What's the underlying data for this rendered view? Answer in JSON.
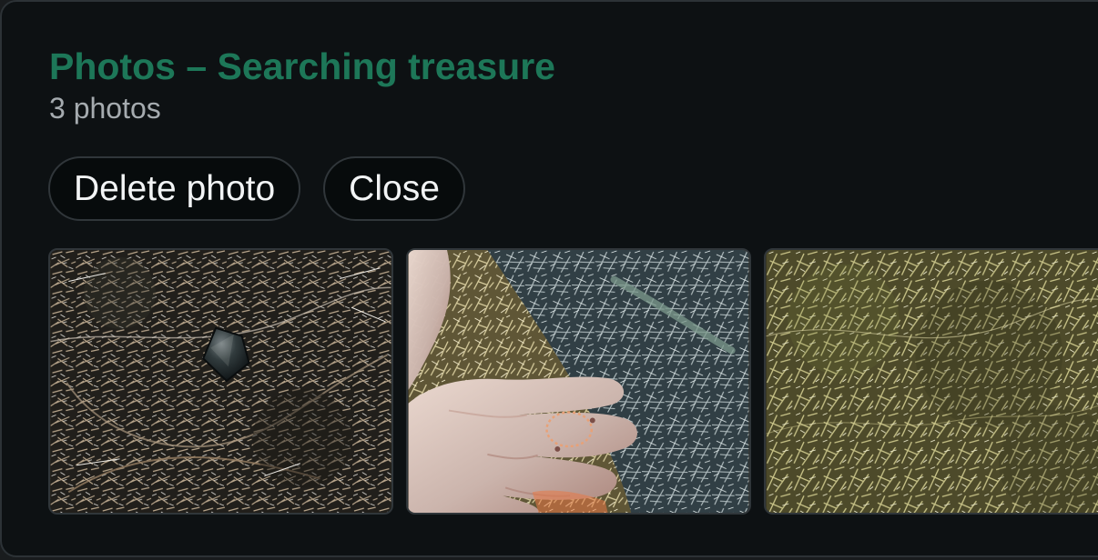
{
  "dialog": {
    "title": "Photos – Searching treasure",
    "subtitle": "3 photos"
  },
  "actions": {
    "delete_label": "Delete photo",
    "close_label": "Close"
  },
  "photos": [
    {
      "subject": "ground-with-rock"
    },
    {
      "subject": "hand-holding-ring"
    },
    {
      "subject": "grass-field"
    }
  ]
}
